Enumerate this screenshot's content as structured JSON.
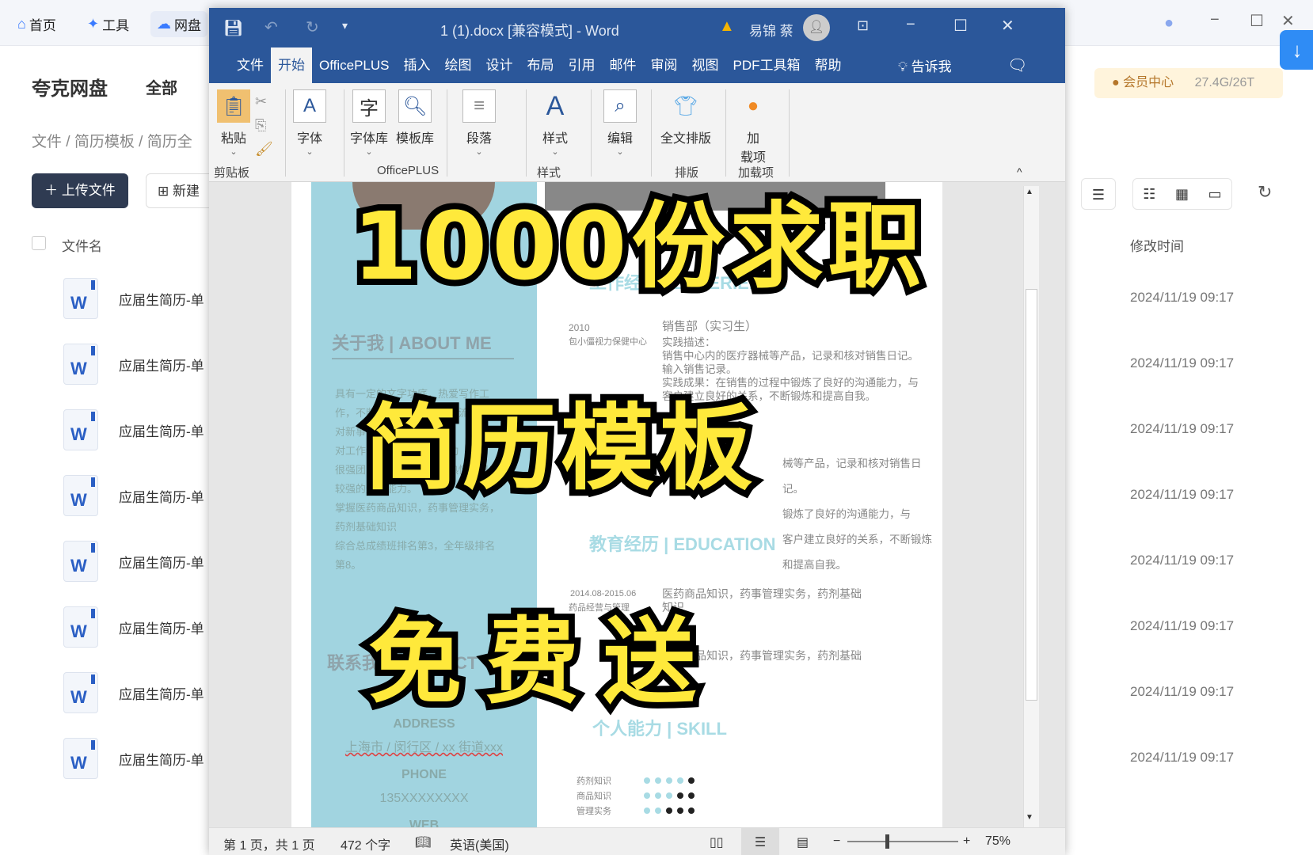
{
  "quark": {
    "nav": [
      "首页",
      "工具",
      "网盘"
    ],
    "brand": "夸克网盘",
    "filter": "全部",
    "breadcrumb": [
      "文件",
      "简历模板",
      "简历全"
    ],
    "upload_label": "上传文件",
    "new_label": "新建",
    "col_name": "文件名",
    "col_modified": "修改时间",
    "member_center": "会员中心",
    "storage": "27.4G/26T",
    "files": [
      {
        "name": "应届生简历-单",
        "modified": "2024/11/19 09:17"
      },
      {
        "name": "应届生简历-单",
        "modified": "2024/11/19 09:17"
      },
      {
        "name": "应届生简历-单",
        "modified": "2024/11/19 09:17"
      },
      {
        "name": "应届生简历-单",
        "modified": "2024/11/19 09:17"
      },
      {
        "name": "应届生简历-单",
        "modified": "2024/11/19 09:17"
      },
      {
        "name": "应届生简历-单",
        "modified": "2024/11/19 09:17"
      },
      {
        "name": "应届生简历-单",
        "modified": "2024/11/19 09:17"
      },
      {
        "name": "应届生简历-单",
        "modified": "2024/11/19 09:17"
      }
    ]
  },
  "word": {
    "title": "1 (1).docx [兼容模式]  -  Word",
    "user": "易锦 蔡",
    "tabs": [
      "文件",
      "开始",
      "OfficePLUS",
      "插入",
      "绘图",
      "设计",
      "布局",
      "引用",
      "邮件",
      "审阅",
      "视图",
      "PDF工具箱",
      "帮助"
    ],
    "tell_me": "告诉我",
    "ribbon": {
      "paste": "粘贴",
      "font": "字体",
      "font_lib": "字体库",
      "template_lib": "模板库",
      "paragraph": "段落",
      "styles": "样式",
      "edit": "编辑",
      "layout_all": "全文排版",
      "addins": "加\n载项",
      "groups": [
        "剪贴板",
        "OfficePLUS",
        "样式",
        "排版",
        "加载项"
      ]
    },
    "doc": {
      "about_title": "关于我 | ABOUT ME",
      "about_lines": [
        "具有一定的文字功底，热爱写作工",
        "作，不断追求进步，紧跟潮流接触",
        "对新事物有兴趣",
        "对工作认真负责，积极主动",
        "很强团队协作精神，待人热情，具有",
        "较强的适应能力。",
        "掌握医药商品知识，药事管理实务，",
        "药剂基础知识",
        "综合总成绩班排名第3，全年级排名",
        "第8。"
      ],
      "contact_title": "联系我 | CONTACT",
      "address_label": "ADDRESS",
      "address": "上海市 / 闵行区 / xx 街道xxx",
      "phone_label": "PHONE",
      "phone": "135XXXXXXXX",
      "web_label": "WEB",
      "exp_title": "工作经验 | EXPERIENCE",
      "exp_year": "2010",
      "exp_org": "包小僵视力保健中心",
      "exp_role": "销售部（实习生）",
      "exp_lines": [
        "实践描述：",
        "销售中心内的医疗器械等产品，记录和核对销售日记。",
        "输入销售记录。",
        "实践成果：在销售的过程中锻炼了良好的沟通能力，与",
        "客户建立良好的关系，不断锻炼和提高自我。"
      ],
      "exp2_lines": [
        "械等产品，记录和核对销售日记。",
        "锻炼了良好的沟通能力，与",
        "客户建立良好的关系，不断锻炼和提高自我。"
      ],
      "edu_title": "教育经历 | EDUCATION",
      "edu_period": "2014.08-2015.06",
      "edu_major": "药品经营与管理",
      "edu_text": "医药商品知识，药事管理实务，药剂基础知识",
      "skill_title": "个人能力 | SKILL",
      "skills": [
        {
          "name": "药剂知识",
          "level": 4
        },
        {
          "name": "商品知识",
          "level": 3
        },
        {
          "name": "管理实务",
          "level": 2
        }
      ]
    },
    "status": {
      "page": "第 1 页，共 1 页",
      "words": "472 个字",
      "language": "英语(美国)",
      "zoom": "75%"
    }
  },
  "overlay": [
    "1000份求职",
    "简历模板",
    "免费送"
  ],
  "colors": {
    "word_blue": "#2b579a",
    "resume_blue": "#a1d4e0",
    "overlay_yellow": "#ffe93b"
  }
}
